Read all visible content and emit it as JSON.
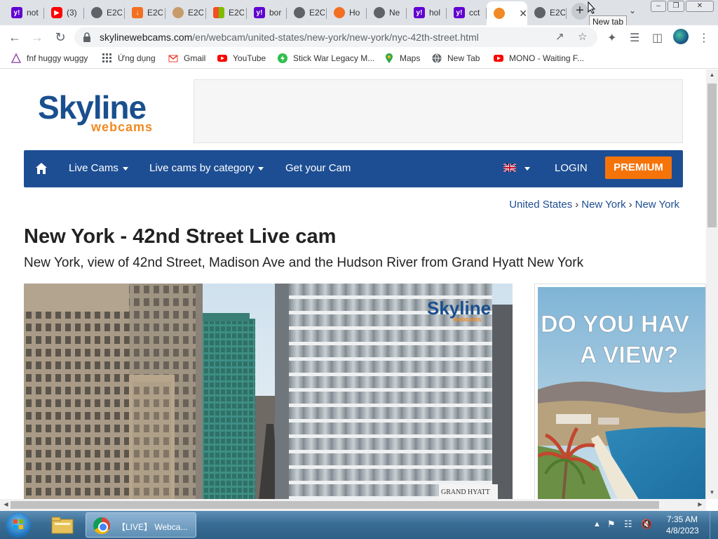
{
  "browser": {
    "tabs": [
      {
        "title": "not",
        "icon": "yahoo-icon"
      },
      {
        "title": "(3)",
        "icon": "youtube-icon"
      },
      {
        "title": "E2C",
        "icon": "globe-icon"
      },
      {
        "title": "E2C",
        "icon": "download-icon"
      },
      {
        "title": "E2C",
        "icon": "avatar-icon"
      },
      {
        "title": "E2C",
        "icon": "windows-logo-icon"
      },
      {
        "title": "bor",
        "icon": "yahoo-icon"
      },
      {
        "title": "E2C",
        "icon": "globe-icon"
      },
      {
        "title": "Ho",
        "icon": "hubspot-icon"
      },
      {
        "title": "Ne",
        "icon": "globe-icon"
      },
      {
        "title": "hol",
        "icon": "yahoo-icon"
      },
      {
        "title": "cct",
        "icon": "yahoo-icon"
      },
      {
        "title": "",
        "icon": "skyline-icon",
        "active": true
      },
      {
        "title": "E2C",
        "icon": "globe-icon"
      }
    ],
    "new_tab_tooltip": "New tab",
    "url_host": "skylinewebcams.com",
    "url_path": "/en/webcam/united-states/new-york/new-york/nyc-42th-street.html",
    "bookmarks": [
      {
        "label": "fnf huggy wuggy",
        "icon": "triangle-icon"
      },
      {
        "label": "Ứng dụng",
        "icon": "apps-grid-icon"
      },
      {
        "label": "Gmail",
        "icon": "gmail-icon"
      },
      {
        "label": "YouTube",
        "icon": "youtube-icon"
      },
      {
        "label": "Stick War Legacy M...",
        "icon": "lightning-icon"
      },
      {
        "label": "Maps",
        "icon": "maps-pin-icon"
      },
      {
        "label": "New Tab",
        "icon": "globe-icon"
      },
      {
        "label": "MONO - Waiting F...",
        "icon": "youtube-icon"
      }
    ]
  },
  "site": {
    "logo_main": "Skyline",
    "logo_sub": "webcams",
    "nav": {
      "live_cams": "Live Cams",
      "by_category": "Live cams by category",
      "get_cam": "Get your Cam",
      "login": "LOGIN",
      "premium": "PREMIUM"
    },
    "breadcrumb": [
      "United States",
      "New York",
      "New York"
    ],
    "title": "New York - 42nd Street Live cam",
    "subtitle": "New York, view of 42nd Street, Madison Ave and the Hudson River from Grand Hyatt New York",
    "cam_watermark_main": "Skyline",
    "cam_watermark_sub": "webcams",
    "cam_hotel_sign": "GRAND HYATT",
    "ad_text_line1": "DO YOU HAV",
    "ad_text_line2": "A VIEW?"
  },
  "taskbar": {
    "chrome_label": "【LIVE】 Webca...",
    "time": "7:35 AM",
    "date": "4/8/2023"
  },
  "colors": {
    "nav_blue": "#1d4e93",
    "premium_orange": "#f5740a",
    "logo_blue": "#1a4f8f",
    "logo_orange": "#f08a24"
  }
}
